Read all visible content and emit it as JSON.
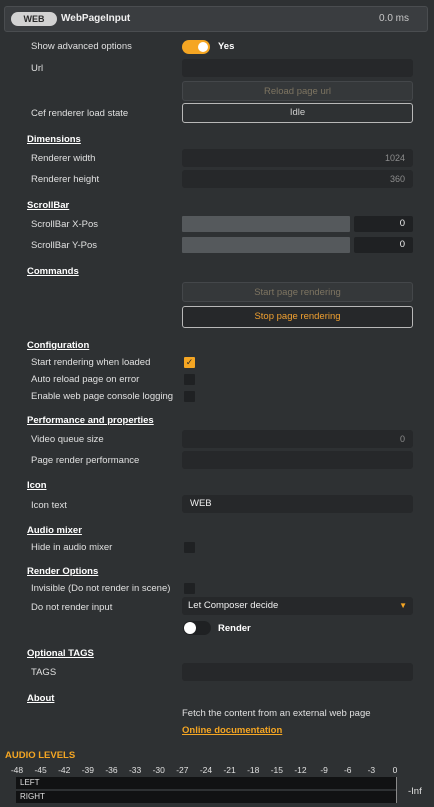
{
  "header": {
    "badge": "WEB",
    "title": "WebPageInput",
    "time": "0.0 ms"
  },
  "general": {
    "show_advanced_label": "Show advanced options",
    "show_advanced_value": "Yes",
    "url_label": "Url",
    "url_value": "",
    "reload_button": "Reload page url",
    "cef_state_label": "Cef renderer load state",
    "cef_state_value": "Idle"
  },
  "dimensions": {
    "section": "Dimensions",
    "width_label": "Renderer width",
    "width_value": "1024",
    "height_label": "Renderer height",
    "height_value": "360"
  },
  "scrollbar": {
    "section": "ScrollBar",
    "x_label": "ScrollBar X-Pos",
    "x_value": "0",
    "y_label": "ScrollBar Y-Pos",
    "y_value": "0"
  },
  "commands": {
    "section": "Commands",
    "start_button": "Start page rendering",
    "stop_button": "Stop page rendering"
  },
  "configuration": {
    "section": "Configuration",
    "items": [
      {
        "label": "Start rendering when loaded",
        "checked": true
      },
      {
        "label": "Auto reload page on error",
        "checked": false
      },
      {
        "label": "Enable web page console logging",
        "checked": false
      }
    ]
  },
  "performance": {
    "section": "Performance and properties",
    "queue_label": "Video queue size",
    "queue_value": "0",
    "render_perf_label": "Page render performance",
    "render_perf_value": ""
  },
  "icon": {
    "section": "Icon",
    "text_label": "Icon text",
    "text_value": "WEB"
  },
  "audio_mixer": {
    "section": "Audio mixer",
    "hide_label": "Hide in audio mixer",
    "hide_checked": false
  },
  "render_options": {
    "section": "Render Options",
    "invisible_label": "Invisible (Do not render in scene)",
    "invisible_checked": false,
    "no_input_label": "Do not render input",
    "no_input_value": "Let Composer decide",
    "render_toggle_label": "Render"
  },
  "tags": {
    "section": "Optional TAGS",
    "label": "TAGS",
    "value": ""
  },
  "about": {
    "section": "About",
    "description": "Fetch the content from an external web page",
    "doc_link": "Online documentation"
  },
  "audio_levels": {
    "title": "AUDIO LEVELS",
    "ticks": [
      "-48",
      "-45",
      "-42",
      "-39",
      "-36",
      "-33",
      "-30",
      "-27",
      "-24",
      "-21",
      "-18",
      "-15",
      "-12",
      "-9",
      "-6",
      "-3",
      "0"
    ],
    "left_label": "LEFT",
    "right_label": "RIGHT",
    "level_text": "-Inf"
  },
  "colors": {
    "accent": "#f5a623",
    "background": "#2e3133",
    "field": "#26282a"
  }
}
